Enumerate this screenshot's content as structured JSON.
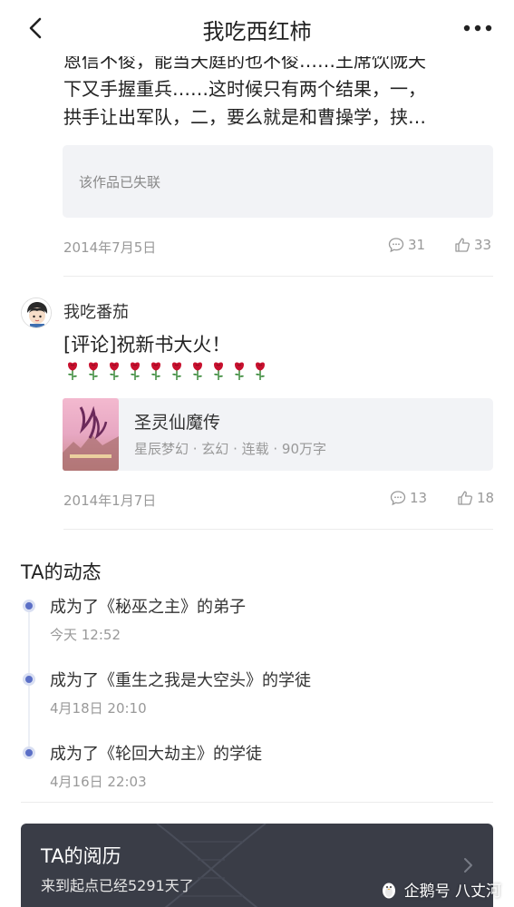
{
  "header": {
    "title": "我吃西红柿",
    "back_icon": "chevron-left-icon",
    "more_icon": "more-dots-icon"
  },
  "post1": {
    "text_lines": [
      "恩信不俊，能当天庭的也不俊……王席饮陇天",
      "下又手握重兵……这时候只有两个结果，一，",
      "拱手让出军队，二，要么就是和曹操学，挟…"
    ],
    "quote": "该作品已失联",
    "date": "2014年7月5日",
    "comments": "31",
    "likes": "33"
  },
  "post2": {
    "username": "我吃番茄",
    "text": "[评论]祝新书大火！",
    "rose_count": 10,
    "book": {
      "title": "圣灵仙魔传",
      "meta": "星辰梦幻 · 玄幻 · 连载 · 90万字"
    },
    "date": "2014年1月7日",
    "comments": "13",
    "likes": "18"
  },
  "activity": {
    "title": "TA的动态",
    "items": [
      {
        "text": "成为了《秘巫之主》的弟子",
        "time": "今天 12:52"
      },
      {
        "text": "成为了《重生之我是大空头》的学徒",
        "time": "4月18日 20:10"
      },
      {
        "text": "成为了《轮回大劫主》的学徒",
        "time": "4月16日 22:03"
      }
    ]
  },
  "history": {
    "title": "TA的阅历",
    "subtitle": "来到起点已经5291天了"
  },
  "watermark": "企鹅号 八丈河",
  "colors": {
    "accent_dot": "#5b6fc6",
    "card_bg": "#f2f3f6",
    "dark_card": "#3a3d47"
  }
}
